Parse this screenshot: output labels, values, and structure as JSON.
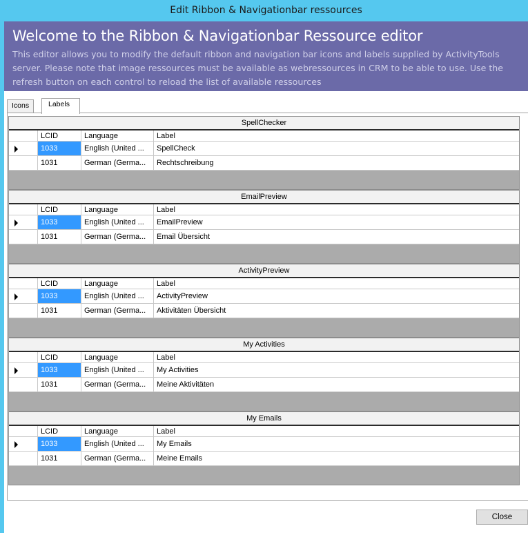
{
  "window": {
    "title": "Edit Ribbon & Navigationbar ressources"
  },
  "banner": {
    "title": "Welcome to the Ribbon & Navigationbar Ressource editor",
    "description": "This editor allows you to modify the default ribbon and navigation bar icons and labels supplied by ActivityTools server. Please note that image ressources must be available as webressources in CRM to be able to use. Use the refresh button on each control to reload the list of available ressources"
  },
  "tabs": [
    {
      "label": "Icons"
    },
    {
      "label": "Labels"
    }
  ],
  "columns": {
    "lcid": "LCID",
    "language": "Language",
    "label": "Label"
  },
  "grids": [
    {
      "caption": "SpellChecker",
      "rows": [
        {
          "lcid": "1033",
          "language": "English (United ...",
          "label": "SpellCheck"
        },
        {
          "lcid": "1031",
          "language": "German (Germa...",
          "label": "Rechtschreibung"
        }
      ]
    },
    {
      "caption": "EmailPreview",
      "rows": [
        {
          "lcid": "1033",
          "language": "English (United ...",
          "label": "EmailPreview"
        },
        {
          "lcid": "1031",
          "language": "German (Germa...",
          "label": "Email Übersicht"
        }
      ]
    },
    {
      "caption": "ActivityPreview",
      "rows": [
        {
          "lcid": "1033",
          "language": "English (United ...",
          "label": "ActivityPreview"
        },
        {
          "lcid": "1031",
          "language": "German (Germa...",
          "label": "Aktivitäten Übersicht"
        }
      ]
    },
    {
      "caption": "My Activities",
      "rows": [
        {
          "lcid": "1033",
          "language": "English (United ...",
          "label": "My Activities"
        },
        {
          "lcid": "1031",
          "language": "German (Germa...",
          "label": "Meine Aktivitäten"
        }
      ]
    },
    {
      "caption": "My Emails",
      "rows": [
        {
          "lcid": "1033",
          "language": "English (United ...",
          "label": "My Emails"
        },
        {
          "lcid": "1031",
          "language": "German (Germa...",
          "label": "Meine Emails"
        }
      ]
    }
  ],
  "footer": {
    "close_label": "Close"
  },
  "colors": {
    "titlebar": "#55c8ef",
    "banner": "#6b6aa8",
    "selection": "#3399ff",
    "grid_background": "#ababab"
  }
}
